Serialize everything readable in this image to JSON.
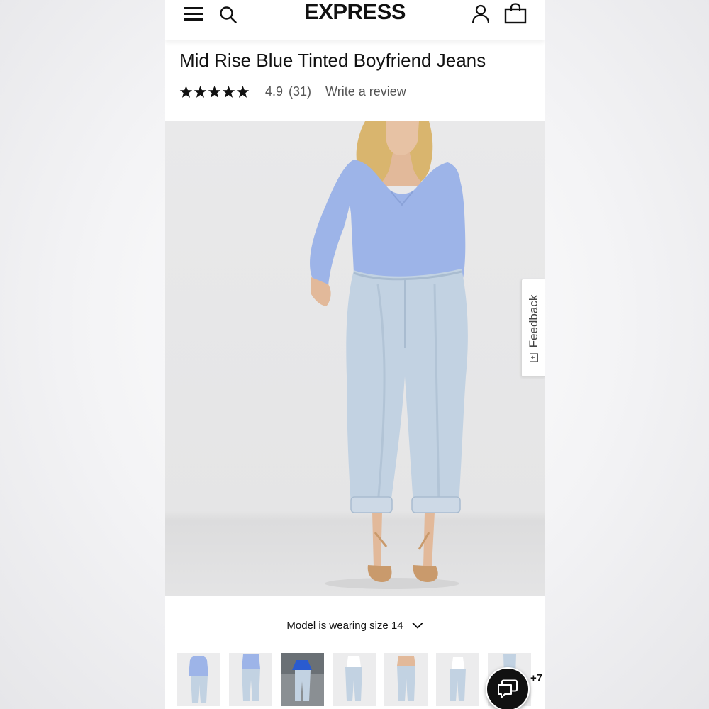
{
  "header": {
    "logo": "EXPRESS",
    "icons": [
      "menu-icon",
      "search-icon",
      "account-icon",
      "shopping-bag-icon"
    ]
  },
  "product": {
    "title": "Mid Rise Blue Tinted Boyfriend Jeans",
    "rating": {
      "stars": 5,
      "value": "4.9",
      "count": "(31)"
    },
    "write_review_label": "Write a review",
    "model_size_label": "Model is wearing size 14"
  },
  "feedback": {
    "label": "Feedback",
    "icon": "feedback-plus-icon"
  },
  "thumbnails": {
    "count_visible": 7,
    "more_label": "+7"
  },
  "chat": {
    "icon": "chat-bubbles-icon"
  },
  "colors": {
    "top": "#9db4e8",
    "denim": "#c2d2e2",
    "skin": "#e2b99a",
    "hair": "#d9b56e",
    "background_photo": "#e8e8e9",
    "text": "#111111"
  }
}
